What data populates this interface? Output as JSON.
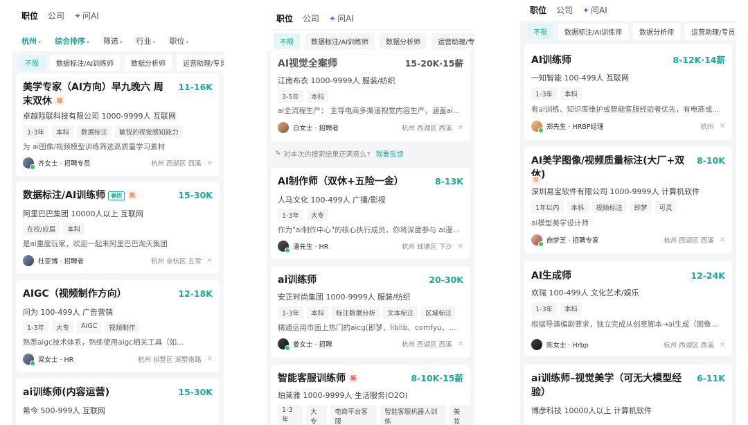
{
  "tabs": {
    "position": "职位",
    "company": "公司",
    "ask_ai": "问AI"
  },
  "filters": [
    "杭州",
    "综合排序",
    "筛选",
    "行业",
    "职位"
  ],
  "chips": [
    "不限",
    "数据标注/AI训练师",
    "数据分析师",
    "运营助理/专员"
  ],
  "feedback": {
    "text": "对本次的搜索结果还满意么?",
    "link": "我要反馈"
  },
  "panel1": [
    {
      "title": "美学专家（AI方向）早九晚六 周末双休",
      "badge": "猎",
      "salary": "11-16K",
      "company": "卓越际联科技有限公司 1000-9999人 互联网",
      "tags": [
        "1-3年",
        "本科",
        "数据标注",
        "敏锐的视觉感知能力"
      ],
      "desc": "为 ai图像/视频模型训练筛选高质量学习素材",
      "recruiter": "齐女士 · 招聘专员",
      "location": "杭州 西湖区 西溪"
    },
    {
      "title": "数据标注/AI训练师",
      "badge": "春招",
      "badge2": "热",
      "salary": "15-30K",
      "company": "阿里巴巴集团 10000人以上 互联网",
      "tags": [
        "在校/应届",
        "本科"
      ],
      "desc": "是ai重度玩家，欢迎一起来阿里巴巴淘天集团",
      "recruiter": "杜亚博 · 招聘者",
      "location": "杭州 余杭区 五常"
    },
    {
      "title": "AIGC（视频制作方向）",
      "salary": "12-18K",
      "company": "问为 100-499人 广告营销",
      "tags": [
        "1-3年",
        "大专",
        "AIGC",
        "视频制作"
      ],
      "desc": "熟悉aigc技术体系，熟练使用aigc相关工具（如...",
      "recruiter": "梁女士 · HR",
      "location": "杭州 拱墅区 湖墅南路"
    },
    {
      "title": "ai训练师(内容运营)",
      "salary": "15-30K",
      "company": "希今 500-999人 互联网"
    }
  ],
  "panel2": [
    {
      "title": "AI视觉全案师",
      "salary": "15-20K·15薪",
      "company": "江南布衣 1000-9999人 服装/纺织",
      "tags": [
        "3-5年",
        "本科"
      ],
      "desc": "ai全流程生产： 主导电商多渠道视觉内容生产，涵盖ai...",
      "recruiter": "白女士 · 招聘者",
      "location": "杭州 西湖区 西溪"
    },
    {
      "title": "AI制作师（双休+五险一金）",
      "salary": "8-13K",
      "company": "人马文化 100-499人 广播/影视",
      "tags": [
        "1-3年",
        "大专"
      ],
      "desc": "作为\"ai制作中心\"的核心执行成员，你将深度参与 ai漫...",
      "recruiter": "潘先生 · HR",
      "location": "杭州 钱塘区 下沙"
    },
    {
      "title": "ai训练师",
      "salary": "20-30K",
      "company": "安正时尚集团 1000-9999人 服装/纺织",
      "tags": [
        "1-3年",
        "本科",
        "标注数据分析",
        "文本标注",
        "区域标注"
      ],
      "desc": "精通运用市面上热门的aicg(即梦、liblib、comfyu、...",
      "recruiter": "姜女士 · 招聘",
      "location": "杭州 西湖区 西溪"
    },
    {
      "title": "智能客服训练师",
      "badge": "新",
      "salary": "8-10K·15薪",
      "company": "珀莱雅 1000-9999人 生活服务(O2O)",
      "tags": [
        "1-3年",
        "大专",
        "电商平台客服",
        "智能客服机器人训练",
        "美妆"
      ]
    }
  ],
  "panel3": [
    {
      "title": "AI训练师",
      "salary": "8-12K·14薪",
      "company": "一知智能 100-499人 互联网",
      "tags": [
        "1-3年",
        "本科"
      ],
      "desc": "有ai训练、知识库维护或智能客服经验者优先，有电商或...",
      "recruiter": "郑先生 · HRBP经理",
      "location": "杭州"
    },
    {
      "title": "AI美学图像/视频质量标注(大厂+双休)",
      "badge": "荐",
      "salary": "8-10K",
      "company": "深圳易宝软件有限公司 1000-9999人 计算机软件",
      "tags": [
        "1年以内",
        "本科",
        "视频标注",
        "即梦",
        "可灵"
      ],
      "desc": "ai模型美学设计师",
      "recruiter": "商梦芝 · 招聘专家",
      "location": "杭州 西湖区 西溪"
    },
    {
      "title": "AI生成师",
      "salary": "12-24K",
      "company": "欢瑞 100-499人 文化艺术/娱乐",
      "tags": [
        "1-3年",
        "本科"
      ],
      "desc": "根据导演编剧要求，独立完成从创意脚本→ai生成（图像...",
      "recruiter": "陈女士 · Hrbp",
      "location": "杭州 西湖区 西溪"
    },
    {
      "title": "ai训练师–视觉美学（可无大模型经验）",
      "salary": "6-11K",
      "company": "博彦科技 10000人以上 计算机软件"
    }
  ]
}
